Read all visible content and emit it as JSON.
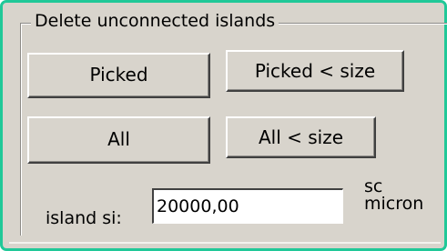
{
  "group": {
    "title": "Delete unconnected islands"
  },
  "buttons": {
    "picked": "Picked",
    "picked_size": "Picked < size",
    "all": "All",
    "all_size": "All < size"
  },
  "island_size": {
    "label": "island si:",
    "value": "20000,00",
    "unit_line1": "sc",
    "unit_line2": "micron"
  },
  "colors": {
    "window_border": "#20c898",
    "face": "#d8d4cc"
  }
}
